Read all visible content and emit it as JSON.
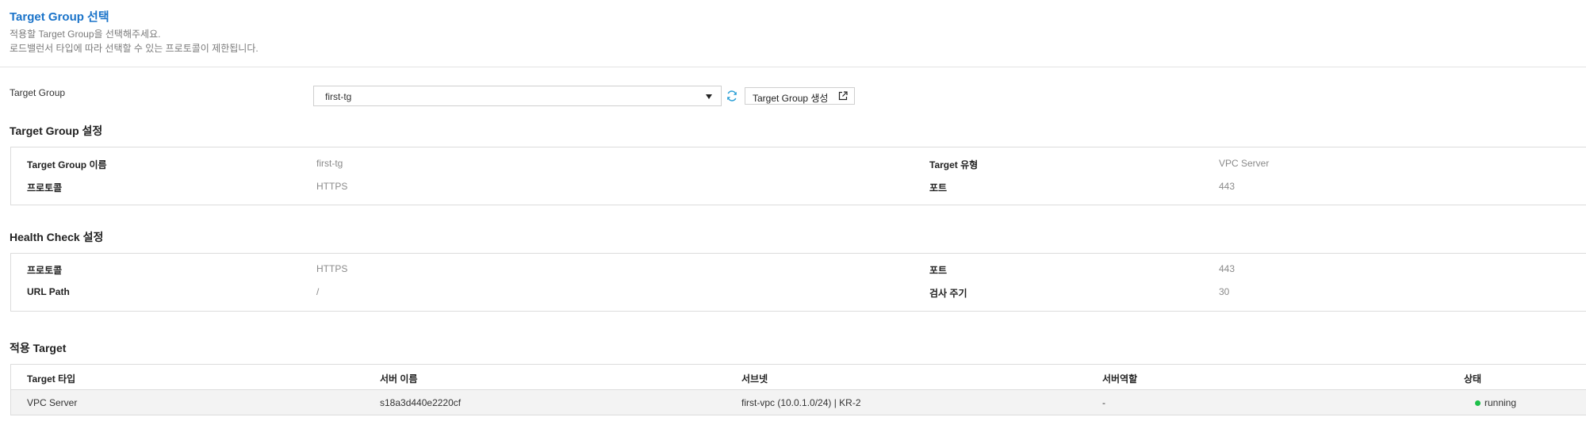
{
  "header": {
    "title": "Target Group 선택",
    "desc_line1": "적용할 Target Group을 선택해주세요.",
    "desc_line2": "로드밸런서 타입에 따라 선택할 수 있는 프로토콜이 제한됩니다."
  },
  "target_group_select": {
    "label": "Target Group",
    "selected": "first-tg",
    "create_button_label": "Target Group 생성",
    "icons": {
      "dropdown": "caret-down-icon",
      "refresh": "refresh-icon",
      "external": "external-link-icon"
    }
  },
  "tg_settings": {
    "title": "Target Group 설정",
    "rows": [
      {
        "left_key": "Target Group 이름",
        "left_value": "first-tg",
        "right_key": "Target 유형",
        "right_value": "VPC Server"
      },
      {
        "left_key": "프로토콜",
        "left_value": "HTTPS",
        "right_key": "포트",
        "right_value": "443"
      }
    ]
  },
  "health_check": {
    "title": "Health Check 설정",
    "rows": [
      {
        "left_key": "프로토콜",
        "left_value": "HTTPS",
        "right_key": "포트",
        "right_value": "443"
      },
      {
        "left_key": "URL Path",
        "left_value": "/",
        "right_key": "검사 주기",
        "right_value": "30"
      }
    ]
  },
  "targets": {
    "title": "적용 Target",
    "columns": [
      "Target 타입",
      "서버 이름",
      "서브넷",
      "서버역할",
      "상태"
    ],
    "rows": [
      [
        "VPC Server",
        "s18a3d440e2220cf",
        "first-vpc (10.0.1.0/24) | KR-2",
        "-",
        "running"
      ]
    ]
  },
  "colors": {
    "accent": "#1a73c9",
    "refresh": "#2a9fd6",
    "status_running": "#1ec04a",
    "border": "#dcdcdc",
    "row_bg": "#f3f3f3"
  }
}
